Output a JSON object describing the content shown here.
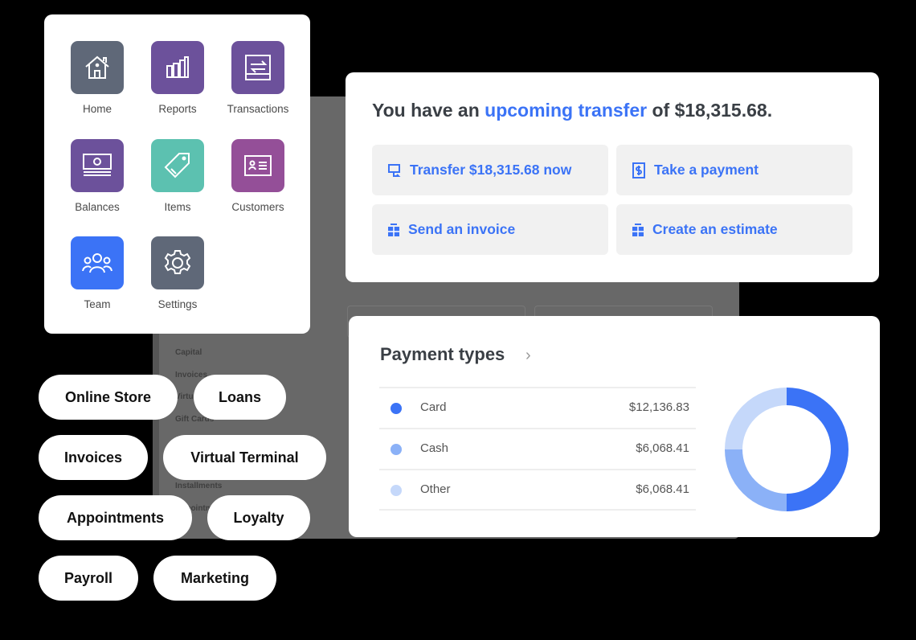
{
  "background_nav": [
    "Capital",
    "Invoices",
    "Virtual Terminal",
    "Gift Cards",
    "Installments",
    "Appointments"
  ],
  "apps": [
    {
      "label": "Home",
      "icon": "home-icon",
      "color": "#5f6878"
    },
    {
      "label": "Reports",
      "icon": "bar-chart-icon",
      "color": "#6c519b"
    },
    {
      "label": "Transactions",
      "icon": "transfer-arrows-icon",
      "color": "#6c519b"
    },
    {
      "label": "Balances",
      "icon": "cash-stack-icon",
      "color": "#6c519b"
    },
    {
      "label": "Items",
      "icon": "tag-icon",
      "color": "#5cc1b0"
    },
    {
      "label": "Customers",
      "icon": "id-card-icon",
      "color": "#944f98"
    },
    {
      "label": "Team",
      "icon": "people-icon",
      "color": "#3b73f6"
    },
    {
      "label": "Settings",
      "icon": "gear-icon",
      "color": "#5f6878"
    }
  ],
  "transfer": {
    "prefix": "You have an ",
    "highlight": "upcoming transfer",
    "suffix": " of $18,315.68.",
    "actions": [
      {
        "label": "Transfer $18,315.68 now",
        "icon": "transfer-monitor-icon"
      },
      {
        "label": "Take a payment",
        "icon": "dollar-doc-icon"
      },
      {
        "label": "Send an invoice",
        "icon": "invoice-icon"
      },
      {
        "label": "Create an estimate",
        "icon": "estimate-icon"
      }
    ],
    "accent": "#3b73f6"
  },
  "payment_types": {
    "title": "Payment types",
    "rows": [
      {
        "name": "Card",
        "value": "$12,136.83",
        "amount": 12136.83,
        "color": "#3b73f6"
      },
      {
        "name": "Cash",
        "value": "$6,068.41",
        "amount": 6068.41,
        "color": "#8bb1f7"
      },
      {
        "name": "Other",
        "value": "$6,068.41",
        "amount": 6068.41,
        "color": "#c5d8fa"
      }
    ]
  },
  "products": [
    "Online Store",
    "Loans",
    "Invoices",
    "Virtual Terminal",
    "Appointments",
    "Loyalty",
    "Payroll",
    "Marketing"
  ]
}
